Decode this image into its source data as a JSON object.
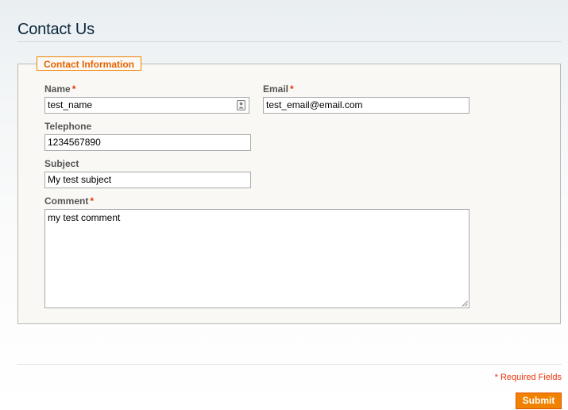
{
  "page": {
    "title": "Contact Us"
  },
  "form": {
    "legend": "Contact Information",
    "required_marker": "*",
    "fields": {
      "name": {
        "label": "Name",
        "value": "test_name",
        "required": true
      },
      "email": {
        "label": "Email",
        "value": "test_email@email.com",
        "required": true
      },
      "telephone": {
        "label": "Telephone",
        "value": "1234567890",
        "required": false
      },
      "subject": {
        "label": "Subject",
        "value": "My test subject",
        "required": false
      },
      "comment": {
        "label": "Comment",
        "value": "my test comment",
        "required": true
      }
    },
    "required_note": "* Required Fields",
    "submit_label": "Submit"
  },
  "colors": {
    "accent": "#f18200",
    "legend_text": "#e76200",
    "required": "#eb340a",
    "title": "#0a263c"
  },
  "icons": {
    "name_field": "contact-card-icon",
    "comment_field": "resize-grip-icon"
  }
}
